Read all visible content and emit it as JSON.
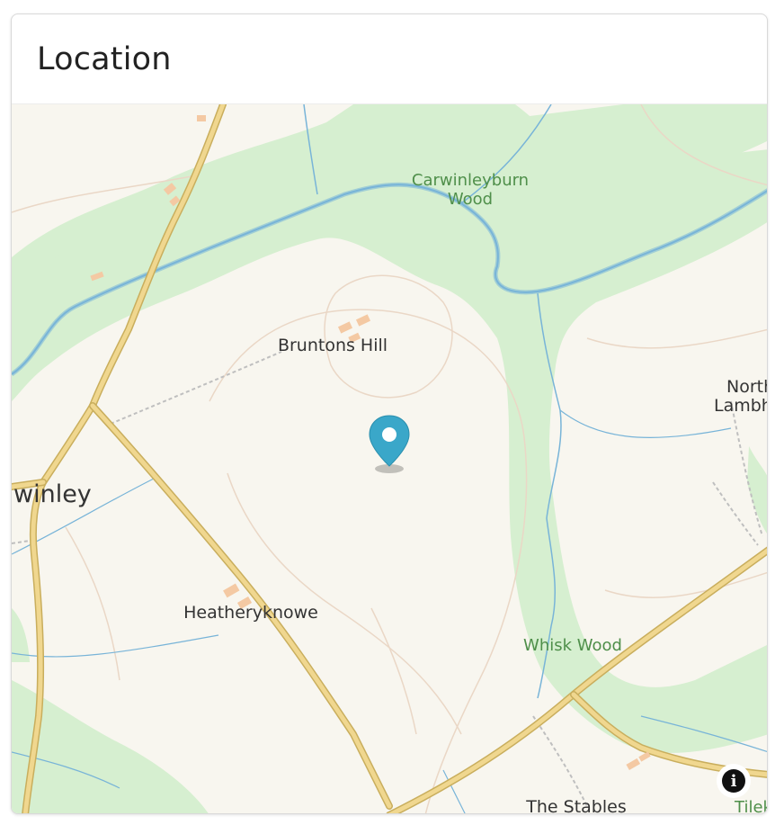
{
  "card": {
    "title": "Location"
  },
  "map": {
    "labels": {
      "carwinleyburn_line1": "Carwinleyburn",
      "carwinleyburn_line2": "Wood",
      "bruntons_hill": "Bruntons Hill",
      "north_line1": "North",
      "north_line2": "Lambh",
      "winley": "winley",
      "heatheryknowe": "Heatheryknowe",
      "whisk_wood": "Whisk Wood",
      "the_stables": "The Stables",
      "tilek": "Tilek"
    },
    "marker_icon": "map-pin-icon",
    "info_icon": "info-icon",
    "info_glyph": "i",
    "colors": {
      "land": "#f8f6ef",
      "wood": "#d6efd0",
      "road": "#f0d78f",
      "road_casing": "#c9ae5d",
      "river": "#78b4d8",
      "contour": "#ead7c6",
      "building": "#f4c9a3",
      "marker": "#3aa7c9"
    }
  }
}
